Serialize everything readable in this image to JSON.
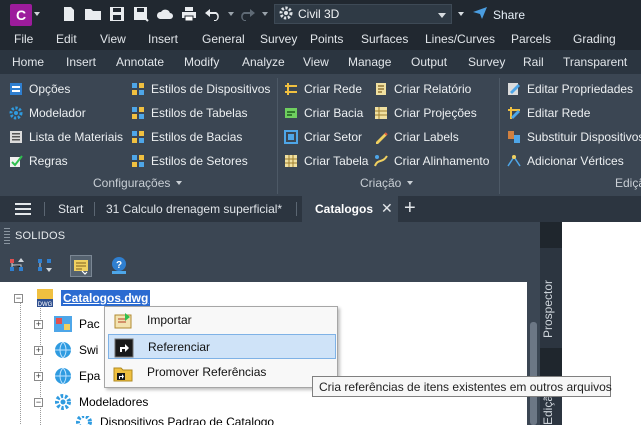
{
  "app": {
    "logo_letter": "C",
    "workspace": "Civil 3D",
    "share_label": "Share"
  },
  "menubar": [
    "File",
    "Edit",
    "View",
    "Insert",
    "General",
    "Survey",
    "Points",
    "Surfaces",
    "Lines/Curves",
    "Parcels",
    "Grading"
  ],
  "ribbon_tabs": [
    "Home",
    "Insert",
    "Annotate",
    "Modify",
    "Analyze",
    "View",
    "Manage",
    "Output",
    "Survey",
    "Rail",
    "Transparent"
  ],
  "ribbon": {
    "configuracoes": {
      "label": "Configurações",
      "col1": [
        "Opções",
        "Modelador",
        "Lista de Materiais",
        "Regras"
      ],
      "col2": [
        "Estilos de Dispositivos",
        "Estilos de Tabelas",
        "Estilos de Bacias",
        "Estilos de Setores"
      ]
    },
    "criacao": {
      "label": "Criação",
      "col1": [
        "Criar Rede",
        "Criar Bacia",
        "Criar Setor",
        "Criar Tabela"
      ],
      "col2": [
        "Criar Relatório",
        "Criar Projeções",
        "Criar Labels",
        "Criar Alinhamento"
      ]
    },
    "edicao": {
      "label": "Ediçã",
      "col1": [
        "Editar Propriedades",
        "Editar Rede",
        "Substituir Dispositivos",
        "Adicionar Vértices"
      ]
    }
  },
  "doc_tabs": {
    "start": "Start",
    "drawing": "31 Calculo drenagem superficial*",
    "active": "Catalogos"
  },
  "palette": {
    "title": "SOLIDOS",
    "side_tab_1": "Prospector",
    "side_tab_2": "Ediçã"
  },
  "tree": {
    "root": "Catalogos.dwg",
    "children": [
      "Pac",
      "Swi",
      "Epa"
    ],
    "modeladores": "Modeladores",
    "last_partial": "Dispositivos Padrao de Catalogo"
  },
  "context_menu": [
    "Importar",
    "Referenciar",
    "Promover Referências"
  ],
  "tooltip": "Cria referências de itens existentes em outros arquivos"
}
